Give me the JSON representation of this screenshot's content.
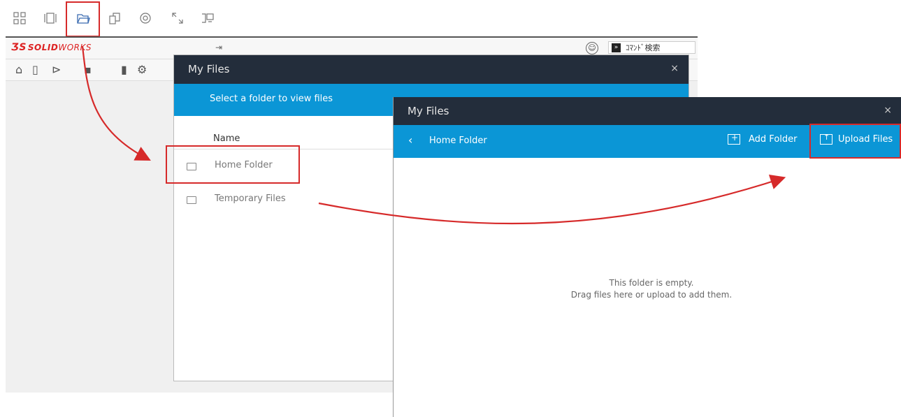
{
  "top_toolbar": {
    "icons": [
      "apps-grid-icon",
      "panels-icon",
      "open-folder-icon",
      "copy-icon",
      "settings-icon",
      "expand-icon",
      "devices-icon"
    ]
  },
  "solidworks": {
    "logo_ds": "ƷS",
    "logo_solid": "SOLID",
    "logo_works": "WORKS",
    "search_placeholder": "ｺﾏﾝﾄﾞ検索"
  },
  "dialog_folders": {
    "title": "My Files",
    "close": "×",
    "subtitle": "Select a folder to view files",
    "column_name": "Name",
    "folders": [
      {
        "label": "Home Folder"
      },
      {
        "label": "Temporary Files"
      }
    ]
  },
  "dialog_home": {
    "title": "My Files",
    "close": "×",
    "back": "‹",
    "current_folder": "Home Folder",
    "add_folder": "Add Folder",
    "upload_files": "Upload Files",
    "empty_line1": "This folder is empty.",
    "empty_line2": "Drag files here or upload to add them."
  },
  "colors": {
    "header_dark": "#232d3b",
    "header_blue": "#0b96d6",
    "highlight_red": "#d62a2a"
  }
}
